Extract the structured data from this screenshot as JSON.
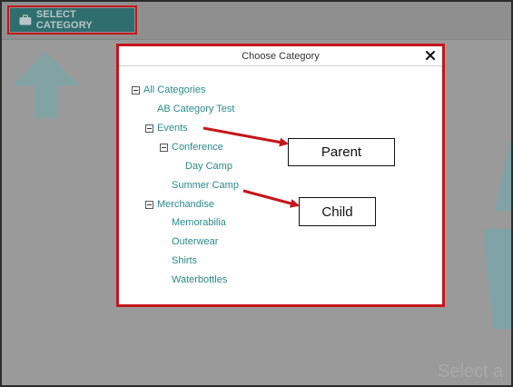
{
  "toolbar": {
    "select_category_label": "SELECT CATEGORY"
  },
  "background": {
    "select_hint_text": "Select a"
  },
  "dialog": {
    "title": "Choose Category",
    "close_glyph": "×",
    "tree": {
      "all_categories": "All Categories",
      "ab_category_test": "AB Category Test",
      "events": "Events",
      "conference": "Conference",
      "day_camp": "Day Camp",
      "summer_camp": "Summer Camp",
      "merchandise": "Merchandise",
      "memorabilia": "Memorabilia",
      "outerwear": "Outerwear",
      "shirts": "Shirts",
      "waterbottles": "Waterbottles"
    }
  },
  "annotations": {
    "parent_label": "Parent",
    "child_label": "Child"
  },
  "colors": {
    "highlight": "#c4161c",
    "link": "#2a8a8a",
    "button": "#2f6e6e"
  },
  "icons": {
    "button_icon": "briefcase-icon",
    "close_icon": "close-icon",
    "toggle_icon": "minus-square-icon"
  }
}
